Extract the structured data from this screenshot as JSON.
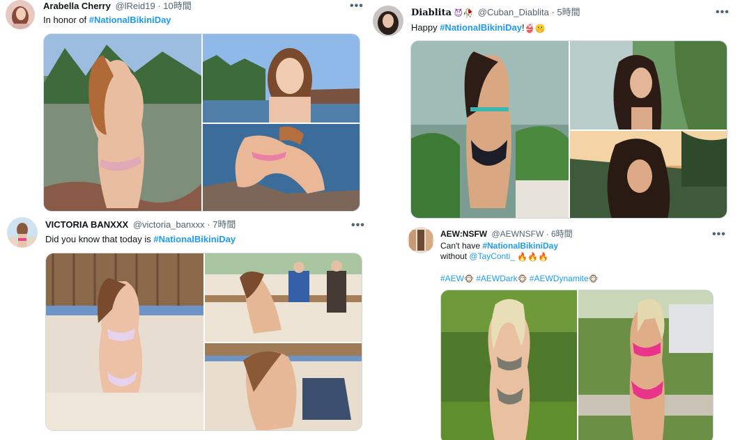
{
  "tweets": [
    {
      "name": "Arabella Cherry",
      "handle": "@lReid19",
      "time": "10時間",
      "text_prefix": "In honor of ",
      "hashtag": "#NationalBikiniDay"
    },
    {
      "name": "VICTORIA BANXXX",
      "handle": "@victoria_banxxx",
      "time": "7時間",
      "text_prefix": "Did you know that today is ",
      "hashtag": "#NationalBikiniDay"
    },
    {
      "name": "Diablita",
      "handle": "@Cuban_Diablita",
      "time": "5時間",
      "text_prefix": "Happy ",
      "hashtag": "#NationalBikiniDay",
      "text_suffix": "!"
    },
    {
      "name": "AEW:NSFW",
      "handle": "@AEWNSFW",
      "time": "6時間",
      "text_prefix": "Can't have ",
      "hashtag": "#NationalBikiniDay",
      "line2_prefix": "without ",
      "mention": "@TayConti_",
      "tags": [
        "#AEW",
        "#AEWDark",
        "#AEWDynamite"
      ]
    }
  ],
  "separator": " · ",
  "more_label": "•••",
  "colors": {
    "link": "#1d9bf0",
    "text": "#0f1419",
    "muted": "#536471",
    "border": "#cfd9de"
  },
  "icons": [
    "more-icon",
    "devil-emoji-icon",
    "rose-emoji-icon",
    "bikini-emoji-icon",
    "shush-emoji-icon",
    "fire-emoji-icon",
    "monkey-emoji-icon"
  ]
}
